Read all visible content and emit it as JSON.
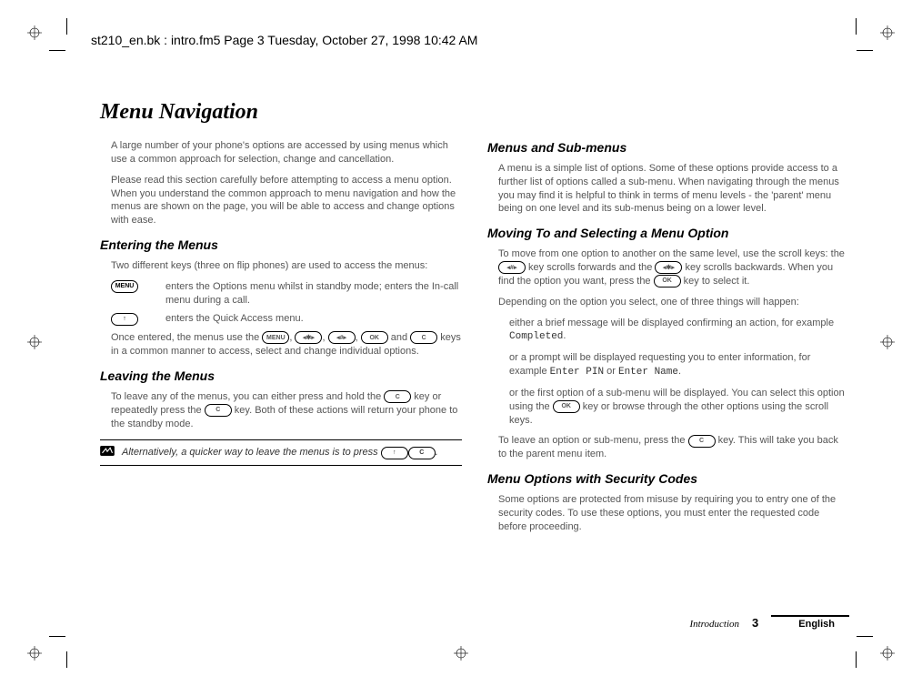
{
  "header": {
    "running_head": "st210_en.bk : intro.fm5  Page 3  Tuesday, October 27, 1998  10:42 AM"
  },
  "title": "Menu Navigation",
  "left": {
    "p1": "A large number of your phone's options are accessed by using menus which use a common approach for selection, change and cancellation.",
    "p2": "Please read this section carefully before attempting to access a menu option. When you understand the common approach to menu navigation and how the menus are shown on the page, you will be able to access and change options with ease.",
    "h_enter": "Entering the Menus",
    "enter_p1": "Two different keys (three on flip phones) are used to access the menus:",
    "key_menu_label": "MENU",
    "key_menu_desc": "enters the Options menu whilst in standby mode; enters the In-call menu during a call.",
    "key_up_label": "↑",
    "key_up_desc": "enters the Quick Access menu.",
    "enter_p2a": "Once entered, the menus use the ",
    "enter_p2b": ", ",
    "enter_p2c": ", ",
    "enter_p2d": ", ",
    "enter_p2e": " and ",
    "enter_p2f": " keys in a common manner to access, select and change individual options.",
    "h_leave": "Leaving the Menus",
    "leave_p1a": "To leave any of the menus, you can either press and hold the ",
    "leave_p1b": " key or repeatedly press the ",
    "leave_p1c": " key. Both of these actions will return your phone to the standby mode.",
    "note_a": "Alternatively, a quicker way to leave the menus is to press ",
    "note_b": "."
  },
  "right": {
    "h_menus": "Menus and Sub-menus",
    "menus_p1": "A menu is a simple list of options. Some of these options provide access to a further list of options called a sub-menu. When navigating through the menus you may find it is helpful to think in terms of menu levels - the 'parent' menu being on one level and its sub-menus being on a lower level.",
    "h_move": "Moving To and Selecting a Menu Option",
    "move_p1a": "To move from one option to another on the same level, use the scroll keys: the ",
    "move_p1b": " key scrolls forwards and the ",
    "move_p1c": " key scrolls backwards. When you find the option you want, press the ",
    "move_p1d": " key to select it.",
    "move_p2": "Depending on the option you select, one of three things will happen:",
    "move_b1a": "either a brief message will be displayed confirming an action, for example ",
    "move_b1b": "Completed",
    "move_b1c": ".",
    "move_b2a": "or a prompt will be displayed requesting you to enter information, for example ",
    "move_b2b": "Enter PIN",
    "move_b2c": " or ",
    "move_b2d": "Enter Name",
    "move_b2e": ".",
    "move_b3a": "or the first option of a sub-menu will be displayed. You can select this option using the ",
    "move_b3b": " key or browse through the other options using the scroll keys.",
    "move_p3a": "To leave an option or sub-menu, press the ",
    "move_p3b": " key. This will take you back to the parent menu item.",
    "h_sec": "Menu Options with Security Codes",
    "sec_p1": "Some options are protected from misuse by requiring you to entry one of the security codes. To use these options, you must enter the requested code before proceeding."
  },
  "keys": {
    "menu": "MENU",
    "star": "◂✱▸",
    "hash": "◂#▸",
    "ok": "OK",
    "c": "C",
    "up": "↑"
  },
  "footer": {
    "section": "Introduction",
    "page": "3",
    "language": "English"
  }
}
